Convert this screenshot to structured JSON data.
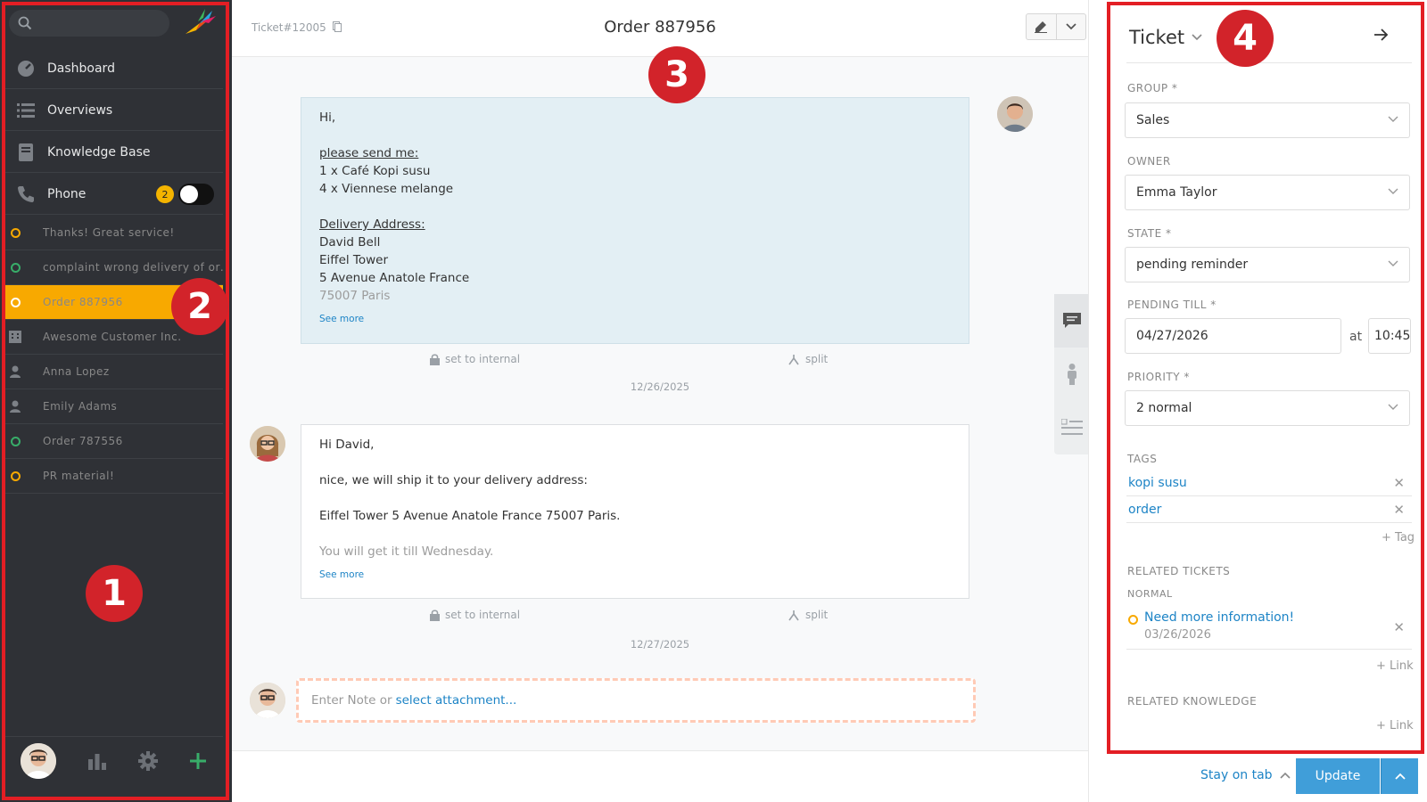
{
  "sidebar": {
    "nav": [
      {
        "label": "Dashboard",
        "icon": "dashboard-icon"
      },
      {
        "label": "Overviews",
        "icon": "list-icon"
      },
      {
        "label": "Knowledge Base",
        "icon": "book-icon"
      },
      {
        "label": "Phone",
        "icon": "phone-icon",
        "badge": "2"
      }
    ],
    "tasks": [
      {
        "label": "Thanks! Great service!",
        "icon": "ticket-icon",
        "status": "orange"
      },
      {
        "label": "complaint wrong delivery of order",
        "icon": "ticket-icon",
        "status": "green"
      },
      {
        "label": "Order 887956",
        "icon": "ticket-icon",
        "status": "active"
      },
      {
        "label": "Awesome Customer Inc.",
        "icon": "organization-icon"
      },
      {
        "label": "Anna Lopez",
        "icon": "user-icon"
      },
      {
        "label": "Emily Adams",
        "icon": "user-icon"
      },
      {
        "label": "Order 787556",
        "icon": "ticket-icon",
        "status": "green"
      },
      {
        "label": "PR material!",
        "icon": "ticket-icon",
        "status": "orange"
      }
    ]
  },
  "callouts": [
    "1",
    "2",
    "3",
    "4"
  ],
  "ticket": {
    "number": "Ticket#12005",
    "title": "Order 887956"
  },
  "articles": [
    {
      "greeting": "Hi,",
      "heading": "please send me:",
      "items": [
        "1 x Café Kopi susu",
        "4 x Viennese melange"
      ],
      "address_heading": "Delivery Address:",
      "address": [
        "David Bell",
        "Eiffel Tower",
        "5 Avenue Anatole France"
      ],
      "faded_line": "75007 Paris",
      "see_more": "See more",
      "set_internal": "set to internal",
      "split": "split",
      "date": "12/26/2025"
    },
    {
      "greeting": "Hi David,",
      "line1": "nice, we will ship it to your delivery address:",
      "line2": "Eiffel Tower 5 Avenue Anatole France 75007 Paris.",
      "faded_line": "You will get it till Wednesday.",
      "see_more": "See more",
      "set_internal": "set to internal",
      "split": "split",
      "date": "12/27/2025"
    }
  ],
  "composer": {
    "placeholder": "Enter Note or",
    "attach": "select attachment..."
  },
  "panel": {
    "title": "Ticket",
    "group_label": "GROUP *",
    "group_value": "Sales",
    "owner_label": "OWNER",
    "owner_value": "Emma Taylor",
    "state_label": "STATE *",
    "state_value": "pending reminder",
    "pending_label": "PENDING TILL *",
    "pending_date": "04/27/2026",
    "pending_at": "at",
    "pending_time": "10:45",
    "priority_label": "PRIORITY *",
    "priority_value": "2 normal",
    "tags_label": "TAGS",
    "tags": [
      "kopi susu",
      "order"
    ],
    "add_tag": "+ Tag",
    "related_label": "RELATED TICKETS",
    "related_group": "NORMAL",
    "related_title": "Need more information!",
    "related_date": "03/26/2026",
    "add_link": "+ Link",
    "knowledge_label": "RELATED KNOWLEDGE",
    "add_link2": "+ Link"
  },
  "footer": {
    "stay_on_tab": "Stay on tab",
    "update": "Update"
  },
  "colors": {
    "sidebar_bg": "#2f3136",
    "active": "#f8a900",
    "accent": "#1d84c6",
    "callout": "#d2232a",
    "update_button": "#409ed9"
  }
}
